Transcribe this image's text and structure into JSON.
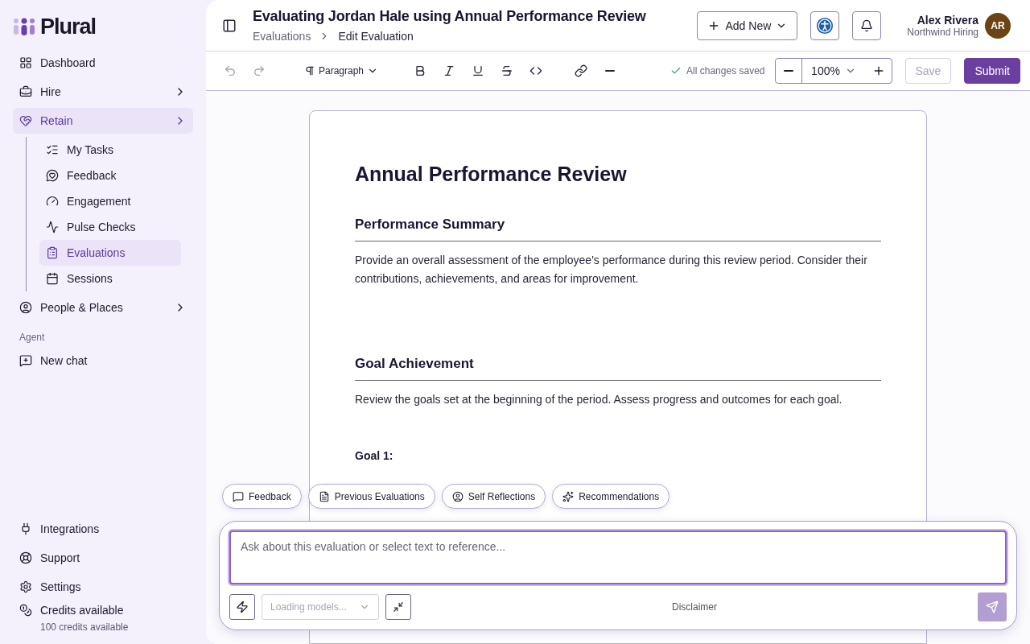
{
  "sidebar": {
    "logo": "Plural",
    "nav": [
      {
        "label": "Dashboard",
        "kind": "link",
        "selected": false
      },
      {
        "label": "Hire",
        "kind": "group",
        "selected": false
      },
      {
        "label": "Retain",
        "kind": "group",
        "selected": true,
        "children": [
          {
            "label": "My Tasks",
            "selected": false
          },
          {
            "label": "Feedback",
            "selected": false
          },
          {
            "label": "Engagement",
            "selected": false
          },
          {
            "label": "Pulse Checks",
            "selected": false
          },
          {
            "label": "Evaluations",
            "selected": true
          },
          {
            "label": "Sessions",
            "selected": false
          }
        ]
      },
      {
        "label": "People & Places",
        "kind": "group",
        "selected": false
      }
    ],
    "section_label": "Agent",
    "agent_items": [
      {
        "label": "New chat"
      }
    ],
    "footer": [
      {
        "label": "Integrations"
      },
      {
        "label": "Support"
      },
      {
        "label": "Settings"
      },
      {
        "label": "Credits available",
        "sub": "100 credits available"
      }
    ]
  },
  "header": {
    "title": "Evaluating Jordan Hale using Annual Performance Review",
    "breadcrumbs": [
      {
        "label": "Evaluations",
        "current": false
      },
      {
        "label": "Edit Evaluation",
        "current": true
      }
    ],
    "add_button": "Add New",
    "user": {
      "name": "Alex Rivera",
      "org": "Northwind Hiring",
      "initials": "AR"
    }
  },
  "toolbar": {
    "block_style": "Paragraph",
    "status": "All changes saved",
    "zoom": "100%",
    "buttons": [
      {
        "label": "Save",
        "disabled": true
      },
      {
        "label": "Submit",
        "disabled": false
      }
    ]
  },
  "document": {
    "title": "Annual Performance Review",
    "sections": [
      {
        "heading": "Performance Summary",
        "body": "Provide an overall assessment of the employee's performance during this review period. Consider their contributions, achievements, and areas for improvement."
      },
      {
        "heading": "Goal Achievement",
        "body": "Review the goals set at the beginning of the period. Assess progress and outcomes for each goal."
      }
    ],
    "goals": [
      "Goal 1:"
    ]
  },
  "chat": {
    "chips": [
      {
        "label": "Feedback"
      },
      {
        "label": "Previous Evaluations"
      },
      {
        "label": "Self Reflections"
      },
      {
        "label": "Recommendations"
      }
    ],
    "placeholder": "Ask about this evaluation or select text to reference...",
    "model_select": "Loading models...",
    "disclaimer": "Disclaimer"
  }
}
